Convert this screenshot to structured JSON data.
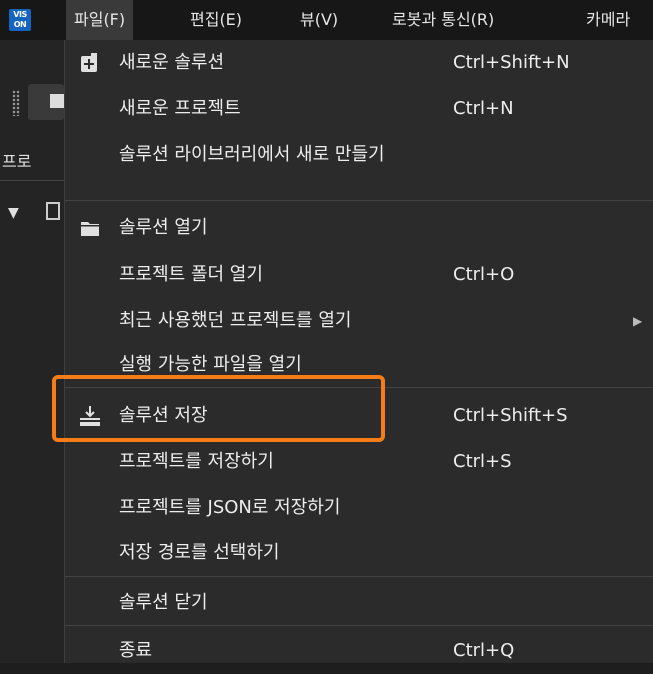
{
  "app": {
    "logo_text": "VIS ON"
  },
  "menubar": {
    "items": [
      {
        "label": "파일(F)"
      },
      {
        "label": "편집(E)"
      },
      {
        "label": "뷰(V)"
      },
      {
        "label": "로봇과 통신(R)"
      },
      {
        "label": "카메라"
      }
    ]
  },
  "left_panel": {
    "title": "프로"
  },
  "file_menu": {
    "items": [
      {
        "label": "새로운 솔루션",
        "shortcut": "Ctrl+Shift+N",
        "icon": "new-solution-icon"
      },
      {
        "label": "새로운 프로젝트",
        "shortcut": "Ctrl+N"
      },
      {
        "label": "솔루션 라이브러리에서 새로 만들기",
        "shortcut": ""
      },
      {
        "label": "솔루션 열기",
        "shortcut": "",
        "icon": "folder-icon"
      },
      {
        "label": "프로젝트 폴더 열기",
        "shortcut": "Ctrl+O"
      },
      {
        "label": "최근 사용했던 프로젝트를 열기",
        "shortcut": "",
        "submenu": true
      },
      {
        "label": "실행 가능한 파일을 열기",
        "shortcut": ""
      },
      {
        "label": "솔루션 저장",
        "shortcut": "Ctrl+Shift+S",
        "icon": "save-icon",
        "highlighted": true
      },
      {
        "label": "프로젝트를 저장하기",
        "shortcut": "Ctrl+S"
      },
      {
        "label": "프로젝트를 JSON로 저장하기",
        "shortcut": ""
      },
      {
        "label": "저장 경로를 선택하기",
        "shortcut": ""
      },
      {
        "label": "솔루션 닫기",
        "shortcut": ""
      },
      {
        "label": "종료",
        "shortcut": "Ctrl+Q"
      }
    ],
    "highlight_color": "#f57c16"
  }
}
